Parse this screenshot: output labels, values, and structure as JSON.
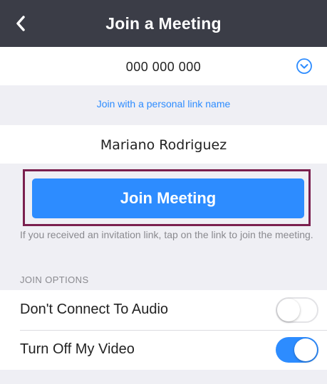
{
  "header": {
    "title": "Join a Meeting",
    "back_icon": "chevron-left-icon"
  },
  "meeting_id": {
    "value": "000 000 000",
    "dropdown_icon": "chevron-down-circle-icon"
  },
  "personal_link": {
    "label": "Join with a personal link name"
  },
  "display_name": {
    "value": "Mariano Rodriguez"
  },
  "join_button": {
    "label": "Join Meeting"
  },
  "hint": {
    "text": "If you received an invitation link, tap on the link to join the meeting."
  },
  "join_options": {
    "header": "JOIN OPTIONS",
    "items": [
      {
        "label": "Don't Connect To Audio",
        "enabled": false
      },
      {
        "label": "Turn Off My Video",
        "enabled": true
      }
    ]
  },
  "colors": {
    "accent": "#2d8cff",
    "topbar": "#3b3d47",
    "highlight": "#7a1f4e"
  }
}
